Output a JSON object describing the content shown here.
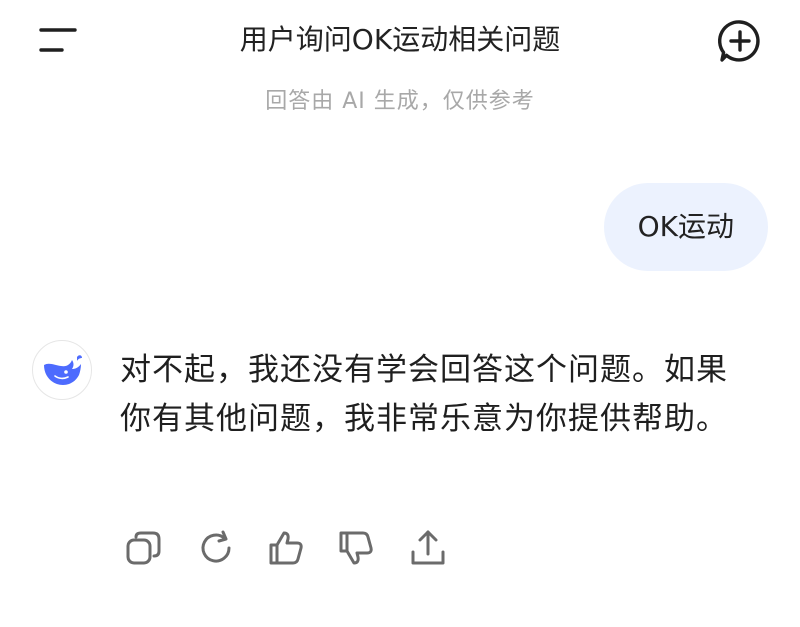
{
  "header": {
    "menu_icon": "menu-icon",
    "title": "用户询问OK运动相关问题",
    "new_chat_icon": "new-chat-plus-icon"
  },
  "notice": "回答由 AI 生成，仅供参考",
  "messages": [
    {
      "role": "user",
      "text": "OK运动"
    },
    {
      "role": "assistant",
      "avatar_icon": "whale-logo-icon",
      "text": "对不起，我还没有学会回答这个问题。如果你有其他问题，我非常乐意为你提供帮助。"
    }
  ],
  "actions": [
    "copy-icon",
    "regenerate-icon",
    "thumbs-up-icon",
    "thumbs-down-icon",
    "share-icon"
  ],
  "colors": {
    "user_bubble": "#ecf2fe",
    "brand_blue": "#4d6bfe",
    "muted_text": "#a8a8a8",
    "icon_gray": "#6b6b6b"
  }
}
